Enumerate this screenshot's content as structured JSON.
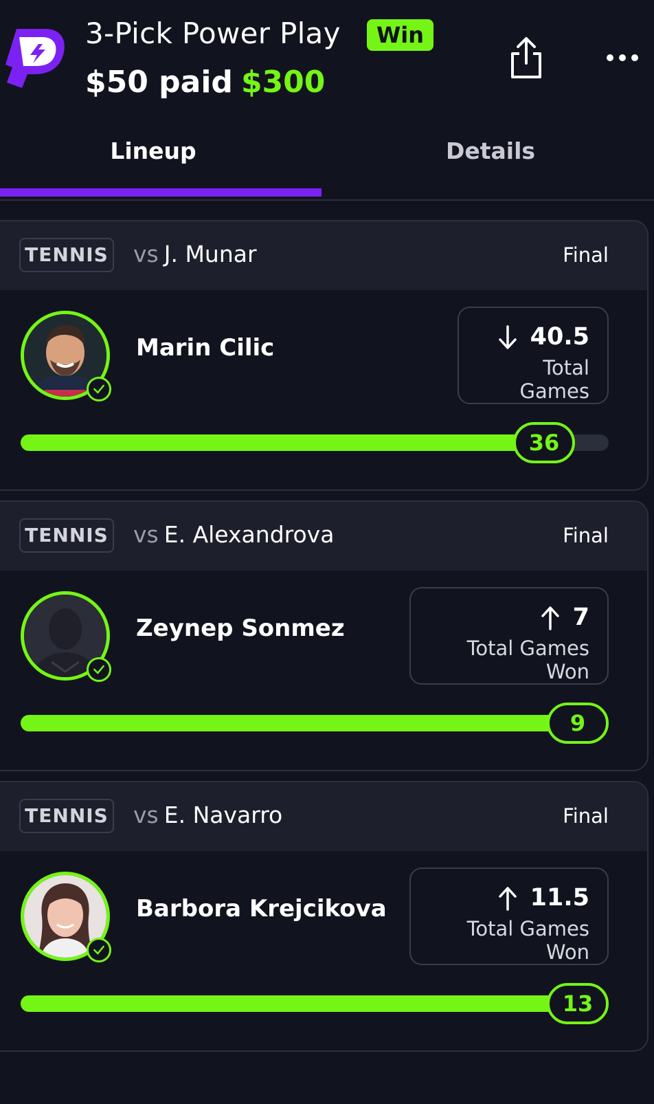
{
  "header": {
    "title": "3-Pick Power Play",
    "result_badge": "Win",
    "paid_text": "$50 paid",
    "payout": "$300"
  },
  "tabs": [
    {
      "label": "Lineup",
      "active": true
    },
    {
      "label": "Details",
      "active": false
    }
  ],
  "colors": {
    "accent_green": "#74f516",
    "accent_purple": "#7b22f3",
    "background": "#11131f"
  },
  "picks": [
    {
      "sport": "TENNIS",
      "vs_prefix": "vs",
      "opponent": "J. Munar",
      "status": "Final",
      "player": "Marin Cilic",
      "direction": "down",
      "line": "40.5",
      "stat": "Total Games",
      "result": "36",
      "progress": 0.89
    },
    {
      "sport": "TENNIS",
      "vs_prefix": "vs",
      "opponent": "E. Alexandrova",
      "status": "Final",
      "player": "Zeynep Sonmez",
      "direction": "up",
      "line": "7",
      "stat": "Total Games Won",
      "result": "9",
      "progress": 1.0
    },
    {
      "sport": "TENNIS",
      "vs_prefix": "vs",
      "opponent": "E. Navarro",
      "status": "Final",
      "player": "Barbora Krejcikova",
      "direction": "up",
      "line": "11.5",
      "stat": "Total Games Won",
      "result": "13",
      "progress": 1.0
    }
  ]
}
